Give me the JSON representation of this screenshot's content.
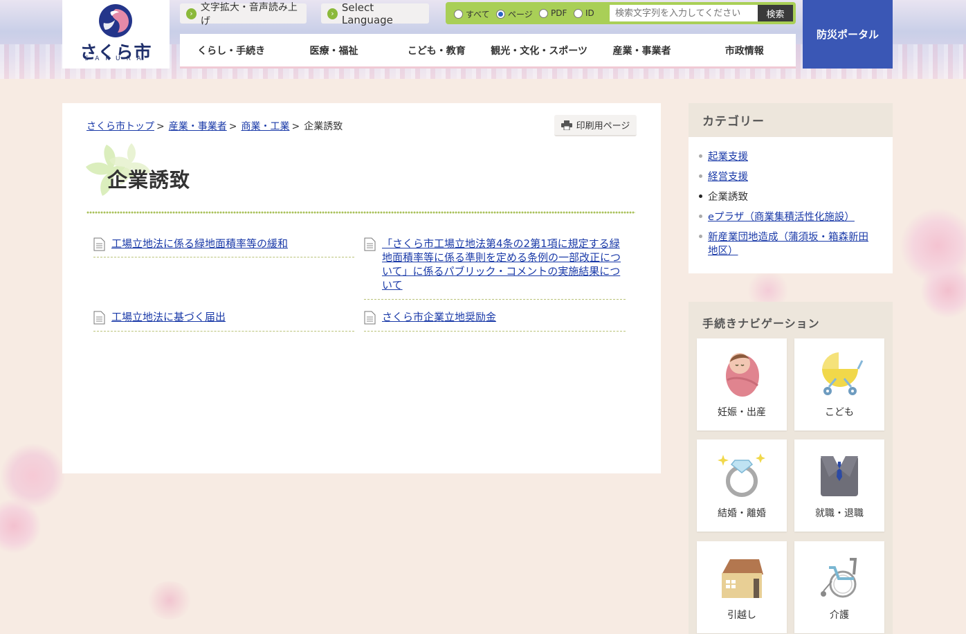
{
  "header": {
    "logo_text": "さくら市",
    "logo_sub": "SAKURA",
    "text_size_label": "文字拡大・音声読み上げ",
    "language_label": "Select Language",
    "search": {
      "options": [
        "すべて",
        "ページ",
        "PDF",
        "ID"
      ],
      "selected": "ページ",
      "placeholder": "検索文字列を入力してください",
      "button": "検索"
    },
    "nav": [
      "くらし・手続き",
      "医療・福祉",
      "こども・教育",
      "観光・文化・スポーツ",
      "産業・事業者",
      "市政情報"
    ],
    "bousai": "防災ポータル"
  },
  "main": {
    "breadcrumb": [
      {
        "label": "さくら市トップ",
        "link": true
      },
      {
        "label": "産業・事業者",
        "link": true
      },
      {
        "label": "商業・工業",
        "link": true
      },
      {
        "label": "企業誘致",
        "link": false
      }
    ],
    "breadcrumb_sep": ">",
    "print_label": "印刷用ページ",
    "title": "企業誘致",
    "links": [
      "工場立地法に係る緑地面積率等の緩和",
      "「さくら市工場立地法第4条の2第1項に規定する緑地面積率等に係る準則を定める条例の一部改正について」に係るパブリック・コメントの実施結果について",
      "工場立地法に基づく届出",
      "さくら市企業立地奨励金"
    ]
  },
  "sidebar": {
    "category_title": "カテゴリー",
    "categories": [
      {
        "label": "起業支援",
        "current": false
      },
      {
        "label": "経営支援",
        "current": false
      },
      {
        "label": "企業誘致",
        "current": true
      },
      {
        "label": "eプラザ（商業集積活性化施設）",
        "current": false
      },
      {
        "label": "新産業団地造成（蒲須坂・箱森新田地区）",
        "current": false
      }
    ],
    "nav_title": "手続きナビゲーション",
    "tiles": [
      {
        "label": "妊娠・出産",
        "icon": "baby-icon"
      },
      {
        "label": "こども",
        "icon": "stroller-icon"
      },
      {
        "label": "結婚・離婚",
        "icon": "ring-icon"
      },
      {
        "label": "就職・退職",
        "icon": "suit-icon"
      },
      {
        "label": "引越し",
        "icon": "house-icon"
      },
      {
        "label": "介護",
        "icon": "wheelchair-icon"
      }
    ]
  },
  "colors": {
    "link": "#1a3aa8",
    "search_green": "#a9cf57",
    "bousai_blue": "#3a57b5",
    "page_bg": "#f7ebe3"
  }
}
